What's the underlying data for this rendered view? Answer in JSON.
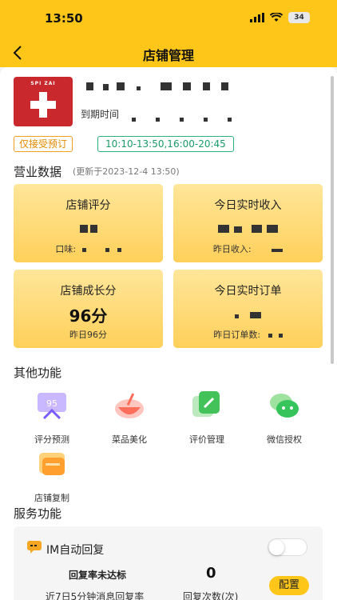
{
  "status_bar": {
    "time": "13:50",
    "battery": "34"
  },
  "nav": {
    "title": "店铺管理"
  },
  "shop": {
    "logo_text": "SPI ZAI",
    "expire_label": "到期时间"
  },
  "tags": {
    "reservation_only": "仅接受预订",
    "business_hours": "10:10-13:50,16:00-20:45"
  },
  "business": {
    "title": "营业数据",
    "updated": "(更新于2023-12-4 13:50)",
    "cards": [
      {
        "title": "店铺评分",
        "sub": "口味:"
      },
      {
        "title": "今日实时收入",
        "sub": "昨日收入:"
      },
      {
        "title": "店铺成长分",
        "value": "96分",
        "sub": "昨日96分"
      },
      {
        "title": "今日实时订单",
        "sub": "昨日订单数:"
      }
    ]
  },
  "other_functions": {
    "title": "其他功能",
    "items": [
      {
        "label": "评分预测",
        "icon": "score-predict-icon"
      },
      {
        "label": "菜品美化",
        "icon": "dish-beautify-icon"
      },
      {
        "label": "评价管理",
        "icon": "review-manage-icon"
      },
      {
        "label": "微信授权",
        "icon": "wechat-icon"
      },
      {
        "label": "店铺复制",
        "icon": "shop-copy-icon"
      }
    ]
  },
  "service": {
    "title": "服务功能",
    "im": {
      "title": "IM自动回复",
      "rate_label": "回复率未达标",
      "reply_count": "0",
      "config": "配置",
      "rate_sub": "近7日5分钟消息回复率",
      "count_sub": "回复次数(次)"
    }
  },
  "colors": {
    "brand_yellow": "#ffc61a",
    "card_gradient_top": "#ffe69a",
    "card_gradient_bottom": "#ffd05a",
    "tag_orange": "#e38a00",
    "tag_green": "#1a9c68"
  }
}
